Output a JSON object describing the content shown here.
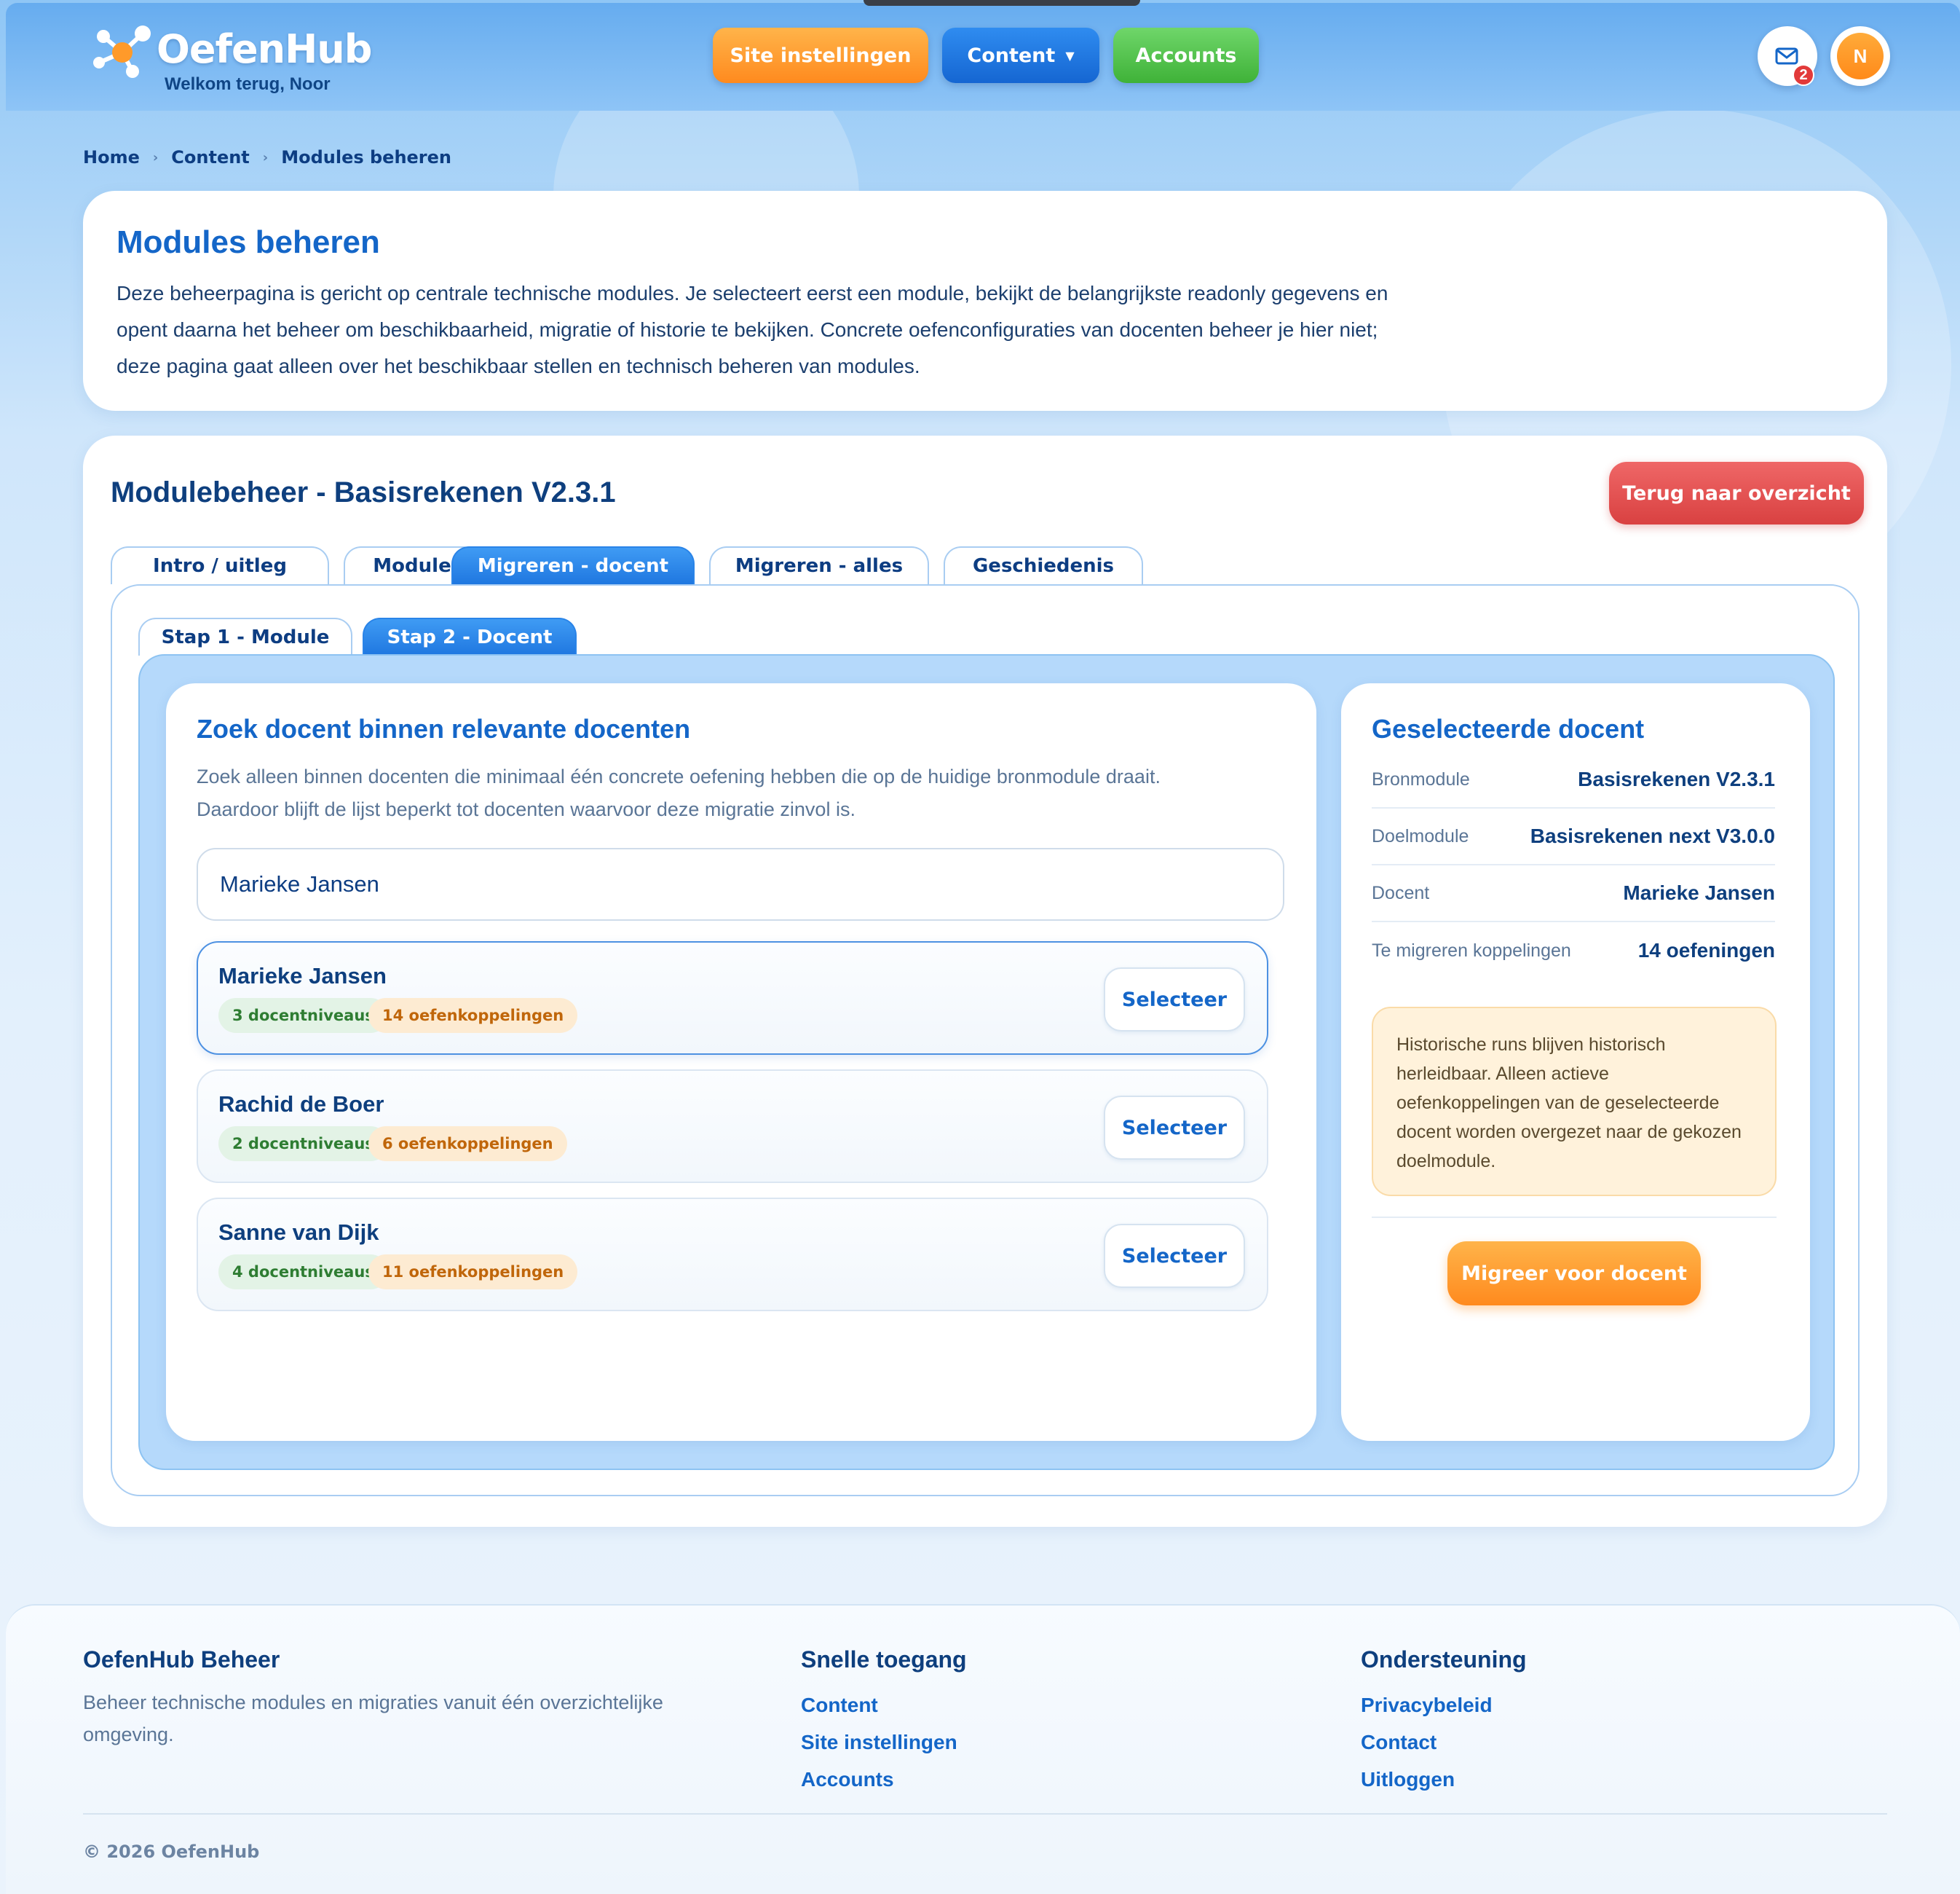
{
  "app": {
    "name": "OefenHub",
    "welcome": "Welkom terug, Noor",
    "avatar_initial": "N",
    "mail_count": "2"
  },
  "nav": {
    "site_settings": "Site instellingen",
    "content": "Content",
    "accounts": "Accounts"
  },
  "breadcrumb": [
    "Home",
    "Content",
    "Modules beheren"
  ],
  "intro": {
    "title": "Modules beheren",
    "lines": [
      "Deze beheerpagina is gericht op centrale technische modules. Je selecteert eerst een module, bekijkt de belangrijkste readonly gegevens en",
      "opent daarna het beheer om beschikbaarheid, migratie of historie te bekijken. Concrete oefenconfiguraties van docenten beheer je hier niet;",
      "deze pagina gaat alleen over het beschikbaar stellen en technisch beheren van modules."
    ]
  },
  "main": {
    "title": "Modulebeheer - Basisrekenen V2.3.1",
    "back_label": "Terug naar overzicht",
    "tabs": [
      "Intro / uitleg",
      "Module",
      "Migreren - docent",
      "Migreren - alles",
      "Geschiedenis"
    ],
    "active_tab": "Migreren - docent",
    "subtabs": [
      "Stap 1 - Module",
      "Stap 2 - Docent"
    ],
    "active_subtab": "Stap 2 - Docent"
  },
  "search": {
    "title": "Zoek docent binnen relevante docenten",
    "desc_lines": [
      "Zoek alleen binnen docenten die minimaal één concrete oefening hebben die op de huidige bronmodule draait.",
      "Daardoor blijft de lijst beperkt tot docenten waarvoor deze migratie zinvol is."
    ],
    "input_value": "Marieke Jansen",
    "select_label": "Selecteer",
    "results": [
      {
        "name": "Marieke Jansen",
        "levels": "3 docentniveaus",
        "links": "14 oefenkoppelingen",
        "selected": true
      },
      {
        "name": "Rachid de Boer",
        "levels": "2 docentniveaus",
        "links": "6 oefenkoppelingen",
        "selected": false
      },
      {
        "name": "Sanne van Dijk",
        "levels": "4 docentniveaus",
        "links": "11 oefenkoppelingen",
        "selected": false
      }
    ]
  },
  "selected": {
    "title": "Geselecteerde docent",
    "rows": [
      {
        "key": "Bronmodule",
        "value": "Basisrekenen V2.3.1"
      },
      {
        "key": "Doelmodule",
        "value": "Basisrekenen next V3.0.0"
      },
      {
        "key": "Docent",
        "value": "Marieke Jansen"
      },
      {
        "key": "Te migreren koppelingen",
        "value": "14 oefeningen"
      }
    ],
    "note": "Historische runs blijven historisch herleidbaar. Alleen actieve oefenkoppelingen van de geselecteerde docent worden overgezet naar de gekozen doelmodule.",
    "migrate_label": "Migreer voor docent"
  },
  "footer": {
    "brand_title": "OefenHub Beheer",
    "brand_desc": "Beheer technische modules en migraties vanuit één overzichtelijke omgeving.",
    "quick_title": "Snelle toegang",
    "quick_links": [
      "Content",
      "Site instellingen",
      "Accounts"
    ],
    "support_title": "Ondersteuning",
    "support_links": [
      "Privacybeleid",
      "Contact",
      "Uitloggen"
    ],
    "copyright": "© 2026 OefenHub"
  },
  "colors": {
    "primary": "#1466c8",
    "orange": "#ff8a1e",
    "green": "#3fb238",
    "red": "#d94141"
  }
}
